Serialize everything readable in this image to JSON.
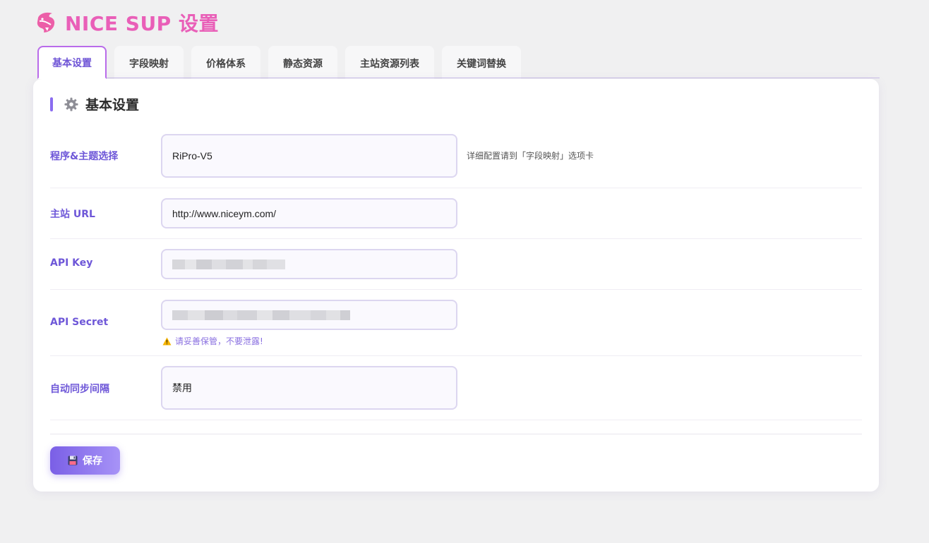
{
  "header": {
    "title": "NICE SUP 设置",
    "logo": "shark-logo-icon",
    "accent_color": "#e95fb8"
  },
  "tabs": [
    {
      "label": "基本设置",
      "active": true
    },
    {
      "label": "字段映射",
      "active": false
    },
    {
      "label": "价格体系",
      "active": false
    },
    {
      "label": "静态资源",
      "active": false
    },
    {
      "label": "主站资源列表",
      "active": false
    },
    {
      "label": "关键词替换",
      "active": false
    }
  ],
  "section": {
    "title": "基本设置",
    "icon": "gear-icon",
    "accent_color": "#8a6cf0"
  },
  "fields": {
    "program_theme": {
      "label": "程序&主题选择",
      "value": "RiPro-V5",
      "hint": "详细配置请到「字段映射」选项卡"
    },
    "main_url": {
      "label": "主站 URL",
      "value": "http://www.niceym.com/"
    },
    "api_key": {
      "label": "API Key",
      "masked": true
    },
    "api_secret": {
      "label": "API Secret",
      "masked": true,
      "warning": "请妥善保管，不要泄露!"
    },
    "sync_interval": {
      "label": "自动同步间隔",
      "value": "禁用"
    }
  },
  "save_button": {
    "label": "保存",
    "icon": "floppy-disk-icon"
  }
}
